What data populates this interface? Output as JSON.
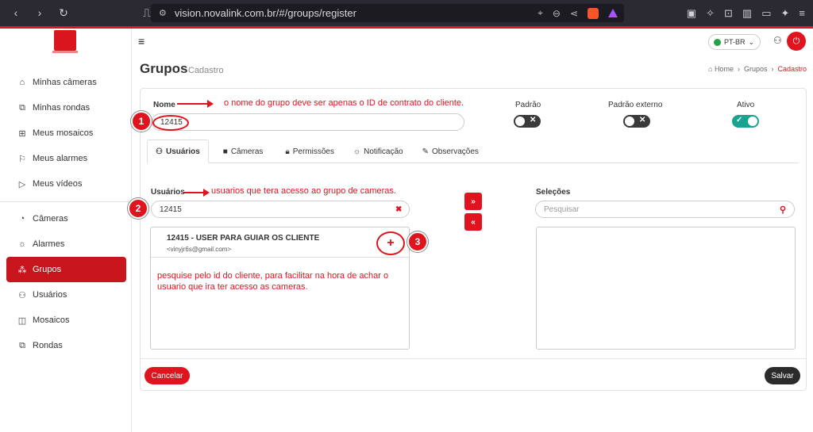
{
  "browser": {
    "url": "vision.novalink.com.br/#/groups/register"
  },
  "sidebar": {
    "items": [
      {
        "label": "Minhas câmeras",
        "icon": "home-icon"
      },
      {
        "label": "Minhas rondas",
        "icon": "rounds-icon"
      },
      {
        "label": "Meus mosaicos",
        "icon": "grid-icon"
      },
      {
        "label": "Meus alarmes",
        "icon": "alarm-icon"
      },
      {
        "label": "Meus vídeos",
        "icon": "play-icon"
      },
      {
        "label": "Câmeras",
        "icon": "camera-icon"
      },
      {
        "label": "Alarmes",
        "icon": "siren-icon"
      },
      {
        "label": "Grupos",
        "icon": "groups-icon"
      },
      {
        "label": "Usuários",
        "icon": "users-icon"
      },
      {
        "label": "Mosaicos",
        "icon": "mosaic-icon"
      },
      {
        "label": "Rondas",
        "icon": "rounds-icon"
      }
    ],
    "active": "Grupos"
  },
  "header": {
    "language": "PT-BR"
  },
  "page": {
    "title": "Grupos",
    "subtitle": "Cadastro",
    "breadcrumb": [
      "Home",
      "Grupos",
      "Cadastro"
    ]
  },
  "form": {
    "name_label": "Nome",
    "name_value": "12415",
    "padrao_label": "Padrão",
    "padrao_externo_label": "Padrão externo",
    "ativo_label": "Ativo",
    "padrao_on": false,
    "padrao_externo_on": false,
    "ativo_on": true
  },
  "tabs": [
    "Usuários",
    "Câmeras",
    "Permissões",
    "Notificação",
    "Observações"
  ],
  "users_panel": {
    "label": "Usuários",
    "search_value": "12415",
    "result_name": "12415 - USER PARA GUIAR OS CLIENTE",
    "result_email": "<vinyjr6s@gmail.com>"
  },
  "selections_panel": {
    "label": "Seleções",
    "search_placeholder": "Pesquisar"
  },
  "buttons": {
    "move_right": "»",
    "move_left": "«",
    "cancel": "Cancelar",
    "save": "Salvar",
    "add": "+"
  },
  "annotations": {
    "name_note": "o nome do grupo deve ser apenas o ID de contrato do cliente.",
    "users_note": "usuarios que tera acesso ao grupo de cameras.",
    "search_note": "pesquise pelo id do cliente, para facilitar na hora de achar o usuario que ira ter acesso as cameras.",
    "badge1": "1",
    "badge2": "2",
    "badge3": "3"
  },
  "colors": {
    "brand_red": "#e0141e",
    "active_toggle": "#1aa38f"
  }
}
